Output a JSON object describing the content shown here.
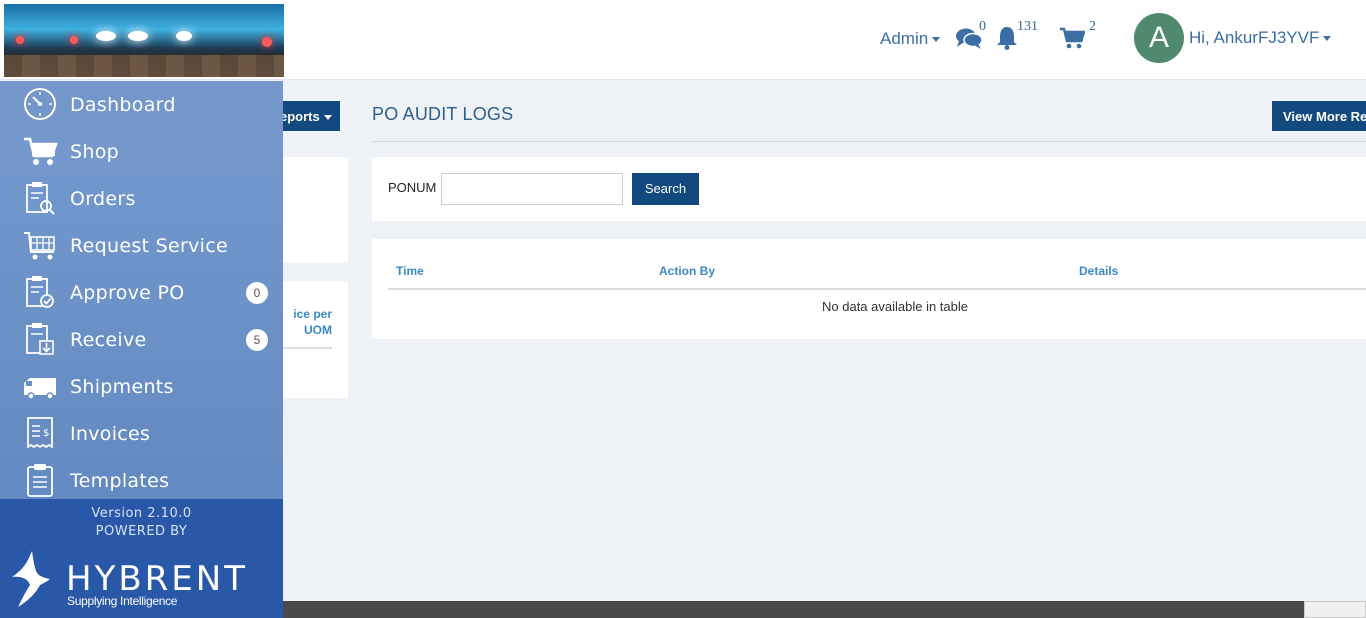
{
  "header": {
    "admin_label": "Admin",
    "messages_count": "0",
    "notifications_count": "131",
    "cart_count": "2",
    "avatar_letter": "A",
    "greeting": "Hi, AnkurFJ3YVF"
  },
  "sidebar": {
    "items": [
      {
        "label": "Dashboard",
        "icon": "dashboard-icon"
      },
      {
        "label": "Shop",
        "icon": "cart-icon"
      },
      {
        "label": "Orders",
        "icon": "clipboard-search-icon"
      },
      {
        "label": "Request Service",
        "icon": "service-cart-icon"
      },
      {
        "label": "Approve PO",
        "icon": "clipboard-check-icon",
        "badge": "0"
      },
      {
        "label": "Receive",
        "icon": "clipboard-download-icon",
        "badge": "5"
      },
      {
        "label": "Shipments",
        "icon": "truck-icon"
      },
      {
        "label": "Invoices",
        "icon": "invoice-icon"
      },
      {
        "label": "Templates",
        "icon": "clipboard-list-icon"
      }
    ],
    "version": "Version 2.10.0",
    "powered_by": "POWERED BY",
    "brand": "HYBRENT",
    "tagline": "Supplying Intelligence"
  },
  "main": {
    "reports_button": "eports",
    "view_more_button": "View More Rep",
    "title": "PO AUDIT LOGS",
    "left_col_header_line1": "ice per",
    "left_col_header_line2": "UOM",
    "search": {
      "label": "PONUM",
      "value": "",
      "placeholder": "",
      "button": "Search"
    },
    "table": {
      "columns": [
        "Time",
        "Action By",
        "Details"
      ],
      "empty_message": "No data available in table"
    }
  }
}
